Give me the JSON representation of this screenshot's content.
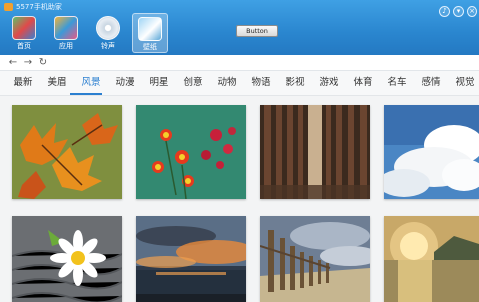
{
  "app": {
    "title": "5577手机助家"
  },
  "toolbar": {
    "nav": [
      {
        "label": "首页",
        "icon": "home-icon"
      },
      {
        "label": "应用",
        "icon": "apps-icon"
      },
      {
        "label": "铃声",
        "icon": "ringtone-icon"
      },
      {
        "label": "壁纸",
        "icon": "wallpaper-icon"
      }
    ],
    "active_nav": "壁纸",
    "center_button_label": "Button"
  },
  "browser": {
    "back_glyph": "←",
    "forward_glyph": "→",
    "refresh_glyph": "↻"
  },
  "categories": {
    "items": [
      "最新",
      "美眉",
      "风景",
      "动漫",
      "明星",
      "创意",
      "动物",
      "物语",
      "影视",
      "游戏",
      "体育",
      "名车",
      "感情",
      "视觉"
    ],
    "active": "风景"
  },
  "gallery": {
    "thumbnails": [
      {
        "subject": "autumn maple leaves"
      },
      {
        "subject": "red and yellow flowers"
      },
      {
        "subject": "forest tree trunks"
      },
      {
        "subject": "clouds and blue sky"
      },
      {
        "subject": "white daisy flower"
      },
      {
        "subject": "sunset over sea"
      },
      {
        "subject": "wooden fence by shore"
      },
      {
        "subject": "sunrise over lake"
      }
    ]
  },
  "colors": {
    "toolbar": "#2a86cf",
    "accent": "#2b7fd0"
  }
}
